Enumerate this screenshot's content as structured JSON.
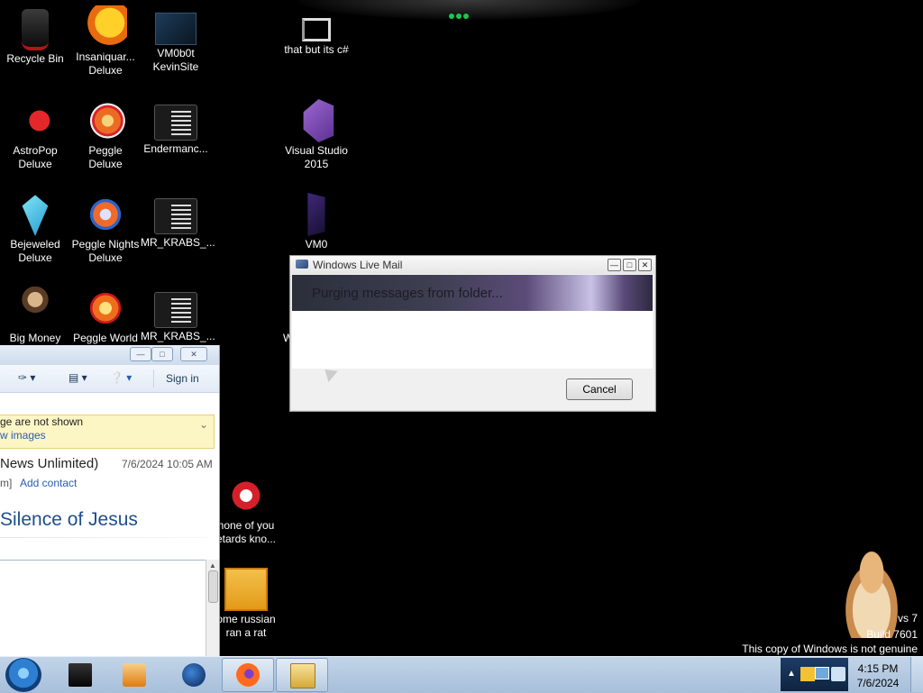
{
  "desktop": {
    "icons": [
      {
        "label": "Recycle Bin",
        "icon": "recycle-bin-icon"
      },
      {
        "label": "Insaniquar...\nDeluxe",
        "icon": "insaniquarium-icon"
      },
      {
        "label": "VM0b0t\nKevinSite",
        "icon": "vm-icon"
      },
      {
        "label": "that but its c#",
        "icon": "shortcut-folder-icon"
      },
      {
        "label": "AstroPop\nDeluxe",
        "icon": "astropop-icon"
      },
      {
        "label": "Peggle Deluxe",
        "icon": "peggle-icon"
      },
      {
        "label": "Endermanc...",
        "icon": "console-app-icon"
      },
      {
        "label": "Visual Studio\n2015",
        "icon": "visual-studio-icon"
      },
      {
        "label": "Bejeweled\nDeluxe",
        "icon": "bejeweled-icon"
      },
      {
        "label": "Peggle Nights\nDeluxe",
        "icon": "peggle-nights-icon"
      },
      {
        "label": "MR_KRABS_...",
        "icon": "console-app-icon"
      },
      {
        "label": "VM0",
        "icon": "vm0-icon"
      },
      {
        "label": "Big Money",
        "icon": "big-money-icon"
      },
      {
        "label": "Peggle World",
        "icon": "peggle-world-icon"
      },
      {
        "label": "MR_KRABS_...",
        "icon": "console-app-icon"
      },
      {
        "label": "W",
        "icon": "hidden-icon"
      },
      {
        "label": "none of you\netards kno...",
        "icon": "red-app-icon"
      },
      {
        "label": "ome russian\nran a rat",
        "icon": "rat-icon"
      }
    ]
  },
  "mail_window": {
    "signin": "Sign in",
    "infobar_line1": "ge are not shown",
    "infobar_line2": "w images",
    "sender": "News Unlimited)",
    "date": "7/6/2024 10:05 AM",
    "address_tail": "m]",
    "add_contact": "Add contact",
    "subject": "Silence of Jesus"
  },
  "dialog": {
    "title": "Windows Live Mail",
    "status": "Purging messages from folder...",
    "cancel": "Cancel"
  },
  "watermark": {
    "line1": "vs 7",
    "line2": "Build 7601",
    "line3": "This copy of Windows is not genuine"
  },
  "taskbar": {
    "time": "4:15 PM",
    "date": "7/6/2024"
  },
  "colors": {
    "desktop": "#000000",
    "taskbar": "#b4c8df",
    "link": "#2a5db0",
    "subject": "#1f4e8c"
  }
}
